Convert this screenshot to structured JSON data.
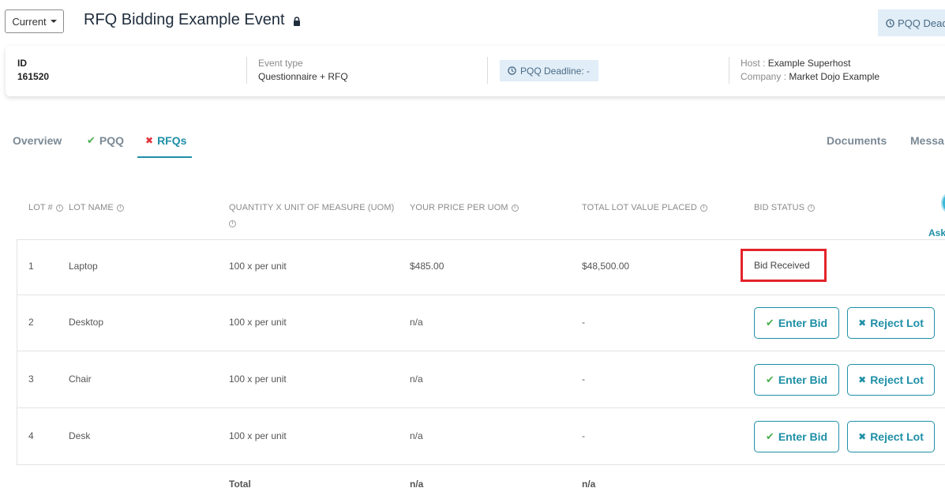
{
  "header": {
    "version_label": "Current",
    "event_title": "RFQ Bidding Example Event",
    "pqq_deadline_top": "PQQ Dead"
  },
  "info": {
    "id_label": "ID",
    "id_value": "161520",
    "event_type_label": "Event type",
    "event_type_value": "Questionnaire + RFQ",
    "pqq_deadline": "PQQ Deadline: -",
    "host_label": "Host :",
    "host_value": "Example Superhost",
    "company_label": "Company :",
    "company_value": "Market Dojo Example"
  },
  "tabs": {
    "overview": "Overview",
    "pqq": "PQQ",
    "rfqs": "RFQs",
    "documents": "Documents",
    "messages": "Messa"
  },
  "table": {
    "headers": {
      "lot_num": "LOT #",
      "lot_name": "LOT NAME",
      "qty_line1": "QUANTITY X UNIT OF MEASURE (UOM)",
      "price": "YOUR PRICE PER UOM",
      "total_value": "TOTAL LOT VALUE PLACED",
      "bid_status": "BID STATUS"
    },
    "ask_label": "Ask",
    "rows": [
      {
        "num": "1",
        "name": "Laptop",
        "qty": "100 x per unit",
        "price": "$485.00",
        "total": "$48,500.00",
        "status": "Bid Received"
      },
      {
        "num": "2",
        "name": "Desktop",
        "qty": "100 x per unit",
        "price": "n/a",
        "total": "-"
      },
      {
        "num": "3",
        "name": "Chair",
        "qty": "100 x per unit",
        "price": "n/a",
        "total": "-"
      },
      {
        "num": "4",
        "name": "Desk",
        "qty": "100 x per unit",
        "price": "n/a",
        "total": "-"
      }
    ],
    "enter_bid_label": "Enter Bid",
    "reject_lot_label": "Reject Lot",
    "total_label": "Total",
    "total_price": "n/a",
    "total_value": "n/a"
  },
  "colors": {
    "accent": "#1e8fa6",
    "highlight_border": "#e3232a",
    "success": "#4caf50",
    "chip_bg": "#e1edf7"
  }
}
